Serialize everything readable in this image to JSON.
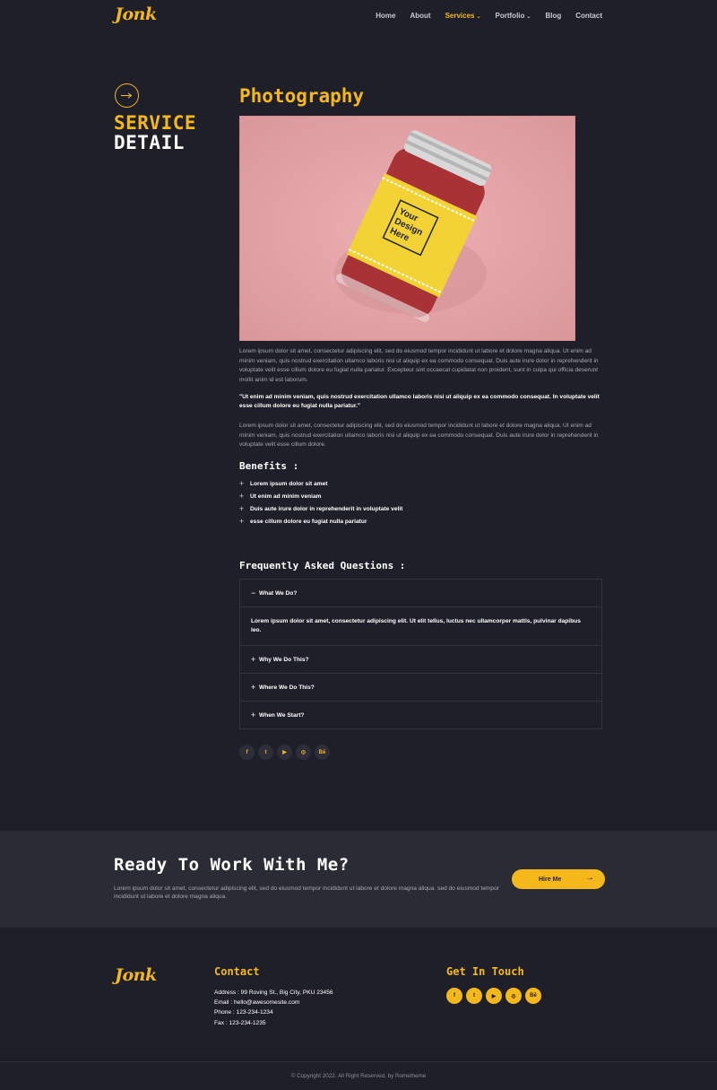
{
  "header": {
    "logo": "Jonk",
    "nav": [
      {
        "label": "Home",
        "active": false,
        "dropdown": false
      },
      {
        "label": "About",
        "active": false,
        "dropdown": false
      },
      {
        "label": "Services",
        "active": true,
        "dropdown": true
      },
      {
        "label": "Portfolio",
        "active": false,
        "dropdown": true
      },
      {
        "label": "Blog",
        "active": false,
        "dropdown": false
      },
      {
        "label": "Contact",
        "active": false,
        "dropdown": false
      }
    ]
  },
  "sidebar": {
    "title_line1": "SERVICE",
    "title_line2": "DETAIL"
  },
  "main": {
    "title": "Photography",
    "image": {
      "label": "Your Design Here"
    },
    "paragraph1": "Lorem ipsum dolor sit amet, consectetur adipiscing elit, sed do eiusmod tempor incididunt ut labore et dolore magna aliqua. Ut enim ad minim veniam, quis nostrud exercitation ullamco laboris nisi ut aliquip ex ea commodo consequat. Duis aute irure dolor in reprehenderit in voluptate velit esse cillum dolore eu fugiat nulla pariatur. Excepteur sint occaecat cupidatat non proident, sunt in culpa qui officia deserunt mollit anim id est laborum.",
    "quote": "\"Ut enim ad minim veniam, quis nostrud exercitation ullamco laboris nisi ut aliquip ex ea commodo consequat. In voluptate velit esse cillum dolore eu fugiat nulla pariatur.\"",
    "paragraph2": "Lorem ipsum dolor sit amet, consectetur adipiscing elit, sed do eiusmod tempor incididunt ut labore et dolore magna aliqua. Ut enim ad minim veniam, quis nostrud exercitation ullamco laboris nisi ut aliquip ex ea commodo consequat. Duis aute irure dolor in reprehenderit in voluptate velit esse cillum dolore.",
    "benefits_title": "Benefits :",
    "benefits": [
      "Lorem ipsum dolor sit amet",
      "Ut enim ad minim veniam",
      "Duis aute irure dolor in reprehenderit in voluptate velit",
      "esse cillum dolore eu fugiat nulla pariatur"
    ],
    "faq_title": "Frequently Asked Questions :",
    "faq": [
      {
        "question": "What We Do?",
        "open": true,
        "answer": "Lorem ipsum dolor sit amet, consectetur adipiscing elit. Ut elit tellus, luctus nec ullamcorper mattis, pulvinar dapibus leo."
      },
      {
        "question": "Why We Do This?",
        "open": false
      },
      {
        "question": "Where We Do This?",
        "open": false
      },
      {
        "question": "When We Start?",
        "open": false
      }
    ],
    "socials": [
      "facebook-icon",
      "twitter-icon",
      "youtube-icon",
      "dribbble-icon",
      "behance-icon"
    ]
  },
  "cta": {
    "title": "Ready To Work With Me?",
    "text": "Lorem ipsum dolor sit amet, consectetur adipiscing elit, sed do eiusmod tempor incididunt ut labore et dolore magna aliqua. sed do eiusmod tempor incididunt ut labore et dolore magna aliqua.",
    "button": "Hire Me"
  },
  "footer": {
    "logo": "Jonk",
    "contact_title": "Contact",
    "address": "Address : 99 Roving St., Big City, PKU 23456",
    "email": "Email : hello@awesomesite.com",
    "phone": "Phone : 123-234-1234",
    "fax": "Fax : 123-234-1235",
    "touch_title": "Get In Touch",
    "socials": [
      "facebook-icon",
      "twitter-icon",
      "youtube-icon",
      "dribbble-icon",
      "behance-icon"
    ],
    "copyright": "© Copyright 2022. All Right Reserved, by Rometheme"
  },
  "colors": {
    "accent": "#f5b81c",
    "background": "#1f1f29",
    "band": "#2b2b36",
    "hero_bg": "#e8a4a7"
  }
}
